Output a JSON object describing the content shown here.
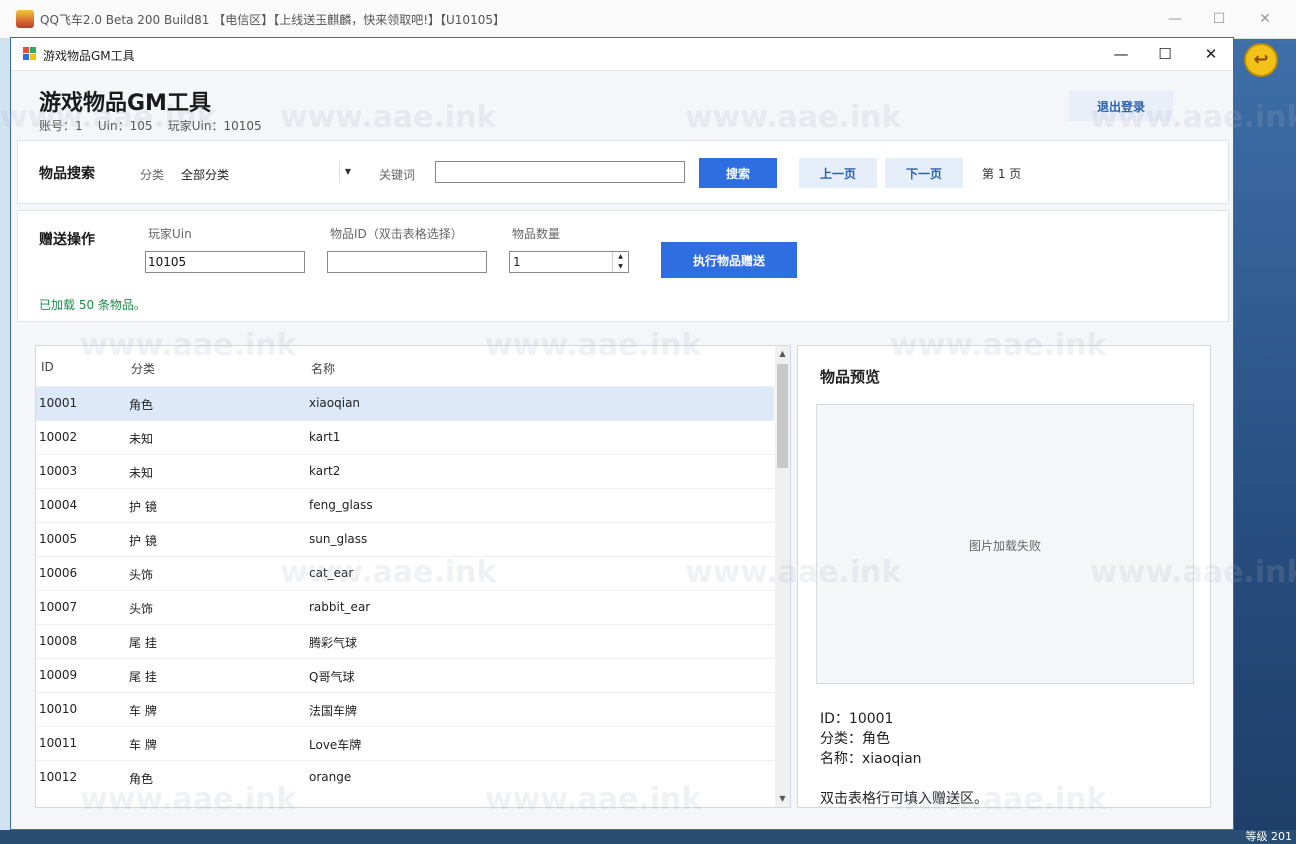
{
  "outer": {
    "title": "QQ飞车2.0 Beta 200 Build81 【电信区】【上线送玉麒麟，快来领取吧!】【U10105】",
    "level": "等级 201"
  },
  "window": {
    "title": "游戏物品GM工具"
  },
  "header": {
    "app_title": "游戏物品GM工具",
    "account_info": "账号：1    Uin：105    玩家Uin：10105",
    "logout_label": "退出登录"
  },
  "search": {
    "section_title": "物品搜索",
    "category_label": "分类",
    "category_value": "全部分类",
    "keyword_label": "关键词",
    "keyword_value": "",
    "search_label": "搜索",
    "prev_label": "上一页",
    "next_label": "下一页",
    "page_text": "第 1 页"
  },
  "gift": {
    "section_title": "赠送操作",
    "uin_label": "玩家Uin",
    "uin_value": "10105",
    "item_id_label": "物品ID（双击表格选择）",
    "item_id_value": "",
    "qty_label": "物品数量",
    "qty_value": "1",
    "execute_label": "执行物品赠送",
    "status_text": "已加载 50 条物品。"
  },
  "table": {
    "columns": [
      "ID",
      "分类",
      "名称"
    ],
    "rows": [
      {
        "id": "10001",
        "category": "角色",
        "name": "xiaoqian"
      },
      {
        "id": "10002",
        "category": "未知",
        "name": "kart1"
      },
      {
        "id": "10003",
        "category": "未知",
        "name": "kart2"
      },
      {
        "id": "10004",
        "category": "护 镜",
        "name": "feng_glass"
      },
      {
        "id": "10005",
        "category": "护 镜",
        "name": "sun_glass"
      },
      {
        "id": "10006",
        "category": "头饰",
        "name": "cat_ear"
      },
      {
        "id": "10007",
        "category": "头饰",
        "name": "rabbit_ear"
      },
      {
        "id": "10008",
        "category": "尾 挂",
        "name": "腾彩气球"
      },
      {
        "id": "10009",
        "category": "尾 挂",
        "name": "Q哥气球"
      },
      {
        "id": "10010",
        "category": "车 牌",
        "name": "法国车牌"
      },
      {
        "id": "10011",
        "category": "车 牌",
        "name": "Love车牌"
      },
      {
        "id": "10012",
        "category": "角色",
        "name": "orange"
      }
    ]
  },
  "preview": {
    "title": "物品预览",
    "image_error": "图片加载失败",
    "id_line": "ID：10001",
    "category_line": "分类：角色",
    "name_line": "名称：xiaoqian",
    "hint": "双击表格行可填入赠送区。"
  },
  "watermark": "www.aae.ink",
  "colors": {
    "primary": "#2f6ee0",
    "light_button": "#e6eef9",
    "selected_row": "#dde9f8",
    "status_green": "#1a8a4a"
  }
}
